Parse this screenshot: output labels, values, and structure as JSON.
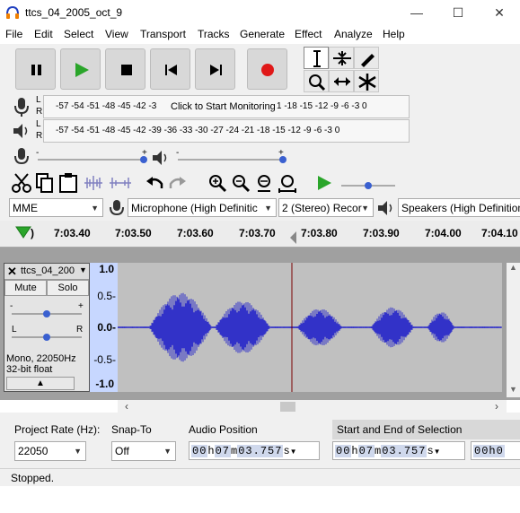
{
  "window": {
    "title": "ttcs_04_2005_oct_9",
    "minimize": "—",
    "maximize": "☐",
    "close": "✕"
  },
  "menu": [
    "File",
    "Edit",
    "Select",
    "View",
    "Transport",
    "Tracks",
    "Generate",
    "Effect",
    "Analyze",
    "Help"
  ],
  "meters": {
    "record_scale": "-57 -54 -51 -48 -45 -42 -3",
    "record_prompt": "Click to Start Monitoring",
    "record_scale_right": "1 -18 -15 -12 -9 -6 -3 0",
    "play_scale": "-57 -54 -51 -48 -45 -42 -39 -36 -33 -30 -27 -24 -21 -18 -15 -12 -9 -6 -3 0",
    "channel_left": "L",
    "channel_right": "R"
  },
  "devices": {
    "host": "MME",
    "input": "Microphone (High Definitic",
    "channels": "2 (Stereo) Recor",
    "output": "Speakers (High Definition"
  },
  "timeline": {
    "labels": [
      "7:03.40",
      "7:03.50",
      "7:03.60",
      "7:03.70",
      "7:03.80",
      "7:03.90",
      "7:04.00",
      "7:04.10"
    ]
  },
  "track": {
    "name": "ttcs_04_200",
    "mute": "Mute",
    "solo": "Solo",
    "pan_left": "L",
    "pan_right": "R",
    "info_line1": "Mono, 22050Hz",
    "info_line2": "32-bit float",
    "scale": [
      "1.0",
      "0.5-",
      "0.0-",
      "-0.5-",
      "-1.0"
    ]
  },
  "bottom": {
    "project_rate_label": "Project Rate (Hz):",
    "project_rate_value": "22050",
    "snap_label": "Snap-To",
    "snap_value": "Off",
    "audio_position_label": "Audio Position",
    "selection_label": "Start and End of Selection",
    "position": {
      "hh": "00",
      "mm": "07",
      "ss": "03.757"
    },
    "selection_start": {
      "hh": "00",
      "mm": "07",
      "ss": "03.757"
    },
    "selection_end_partial": "00h0"
  },
  "status": "Stopped.",
  "colors": {
    "waveform": "#3232c8",
    "play_green": "#2aa52a",
    "record_red": "#e01818",
    "cursor_line": "#7a0000"
  }
}
